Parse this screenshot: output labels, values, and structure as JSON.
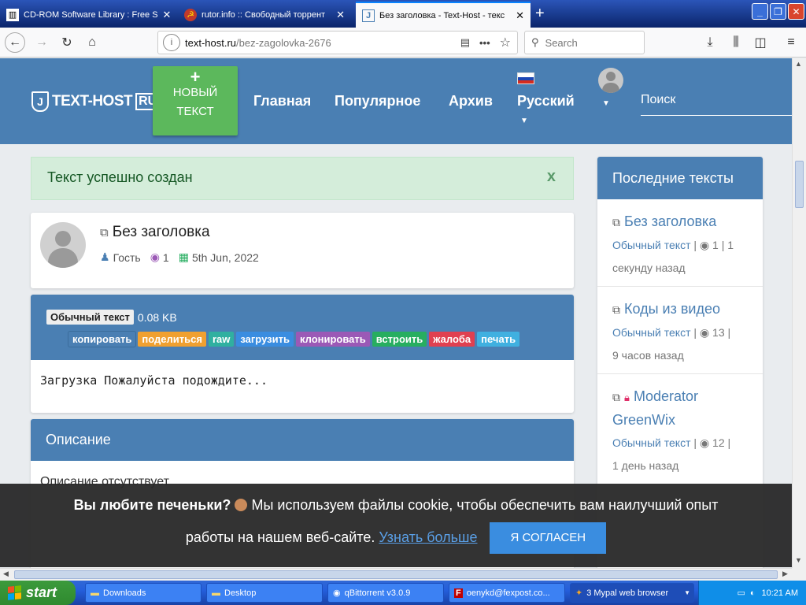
{
  "browser": {
    "tabs": [
      {
        "title": "CD-ROM Software Library : Free S",
        "icon": "library-icon"
      },
      {
        "title": "rutor.info :: Свободный торрент",
        "icon": "rutor-icon"
      },
      {
        "title": "Без заголовка - Text-Host - текс",
        "icon": "texthost-icon"
      }
    ],
    "new_tab_label": "+",
    "url": "text-host.ru/bez-zagolovka-2676",
    "url_host": "text-host.ru",
    "url_path": "/bez-zagolovka-2676",
    "search_placeholder": "Search",
    "more_label": "•••"
  },
  "site": {
    "logo_text": "TEXT-HOST",
    "logo_suffix": "RU",
    "new_text": {
      "plus": "+",
      "line1": "НОВЫЙ",
      "line2": "ТЕКСТ"
    },
    "nav": {
      "home": "Главная",
      "popular": "Популярное",
      "archive": "Архив",
      "language": "Русский"
    },
    "search_placeholder": "Поиск",
    "accent": "#4a7fb3"
  },
  "alert": {
    "message": "Текст успешно создан",
    "close": "x"
  },
  "post": {
    "title": "Без заголовка",
    "author": "Гость",
    "views": "1",
    "date": "5th Jun, 2022"
  },
  "toolbar": {
    "syntax": "Обычный текст",
    "size": "0.08 KB",
    "buttons": [
      {
        "label": "копировать",
        "color": "#4a7fb3"
      },
      {
        "label": "поделиться",
        "color": "#f0a030"
      },
      {
        "label": "raw",
        "color": "#30b0a0"
      },
      {
        "label": "загрузить",
        "color": "#3a8de0"
      },
      {
        "label": "клонировать",
        "color": "#9b59b6"
      },
      {
        "label": "встроить",
        "color": "#27ae60"
      },
      {
        "label": "жалоба",
        "color": "#e04050"
      },
      {
        "label": "печать",
        "color": "#40b0e0"
      }
    ]
  },
  "content": {
    "text": "Загрузка Пожалуйста подождите..."
  },
  "description": {
    "heading": "Описание",
    "text": "Описание отсутствует"
  },
  "sidebar": {
    "heading": "Последние тексты",
    "items": [
      {
        "title": "Без заголовка",
        "syntax": "Обычный текст",
        "views": "1",
        "extra": "| 1",
        "time": "секунду назад",
        "locked": false
      },
      {
        "title": "Коды из видео",
        "syntax": "Обычный текст",
        "views": "13",
        "extra": "|",
        "time": "9 часов назад",
        "locked": false
      },
      {
        "title": "Moderator GreenWix",
        "syntax": "Обычный текст",
        "views": "12",
        "extra": "|",
        "time": "1 день назад",
        "locked": true
      }
    ]
  },
  "cookie": {
    "question": "Вы любите печеньки?",
    "message_line1": "Мы используем файлы cookie, чтобы обеспечить вам наилучший опыт",
    "message_line2": "работы на нашем веб-сайте.",
    "learn_more": "Узнать больше",
    "accept": "Я СОГЛАСЕН"
  },
  "taskbar": {
    "start": "start",
    "tasks": [
      "Downloads",
      "Desktop",
      "qBittorrent v3.0.9",
      "oenykd@fexpost.co...",
      "3 Mypal web browser"
    ],
    "clock": "10:21 AM"
  }
}
